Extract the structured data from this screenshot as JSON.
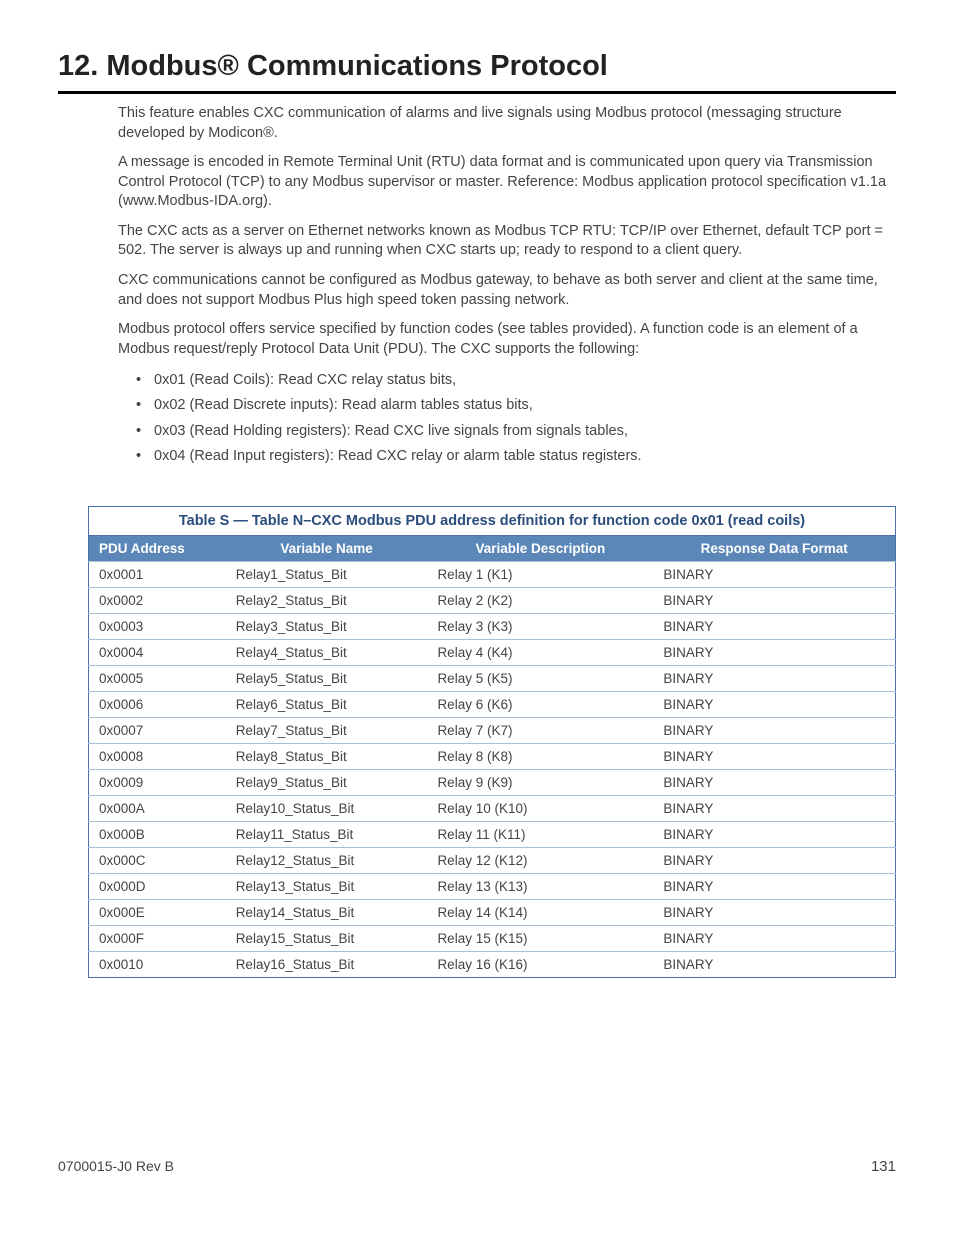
{
  "heading": "12.    Modbus® Communications Protocol",
  "paragraphs": [
    "This feature enables CXC communication of alarms and live signals using Modbus protocol (messaging structure developed by Modicon®.",
    "A message is encoded in Remote Terminal Unit (RTU) data format and is communicated upon query via Transmission Control Protocol (TCP) to any Modbus supervisor or master. Reference: Modbus application protocol specification v1.1a (www.Modbus-IDA.org).",
    "The CXC acts as a server on Ethernet networks known as Modbus TCP RTU: TCP/IP over Ethernet, default TCP port = 502. The server is always up and running when CXC starts up; ready to respond to a client query.",
    "CXC communications cannot be configured as Modbus gateway, to behave as both server and client at the same time, and does not support Modbus Plus high speed token passing network.",
    "Modbus protocol offers service specified by function codes (see tables provided). A function code is an element of a Modbus request/reply Protocol Data Unit (PDU). The CXC supports the following:"
  ],
  "bullets": [
    "0x01 (Read Coils): Read CXC relay status bits,",
    "0x02 (Read Discrete inputs): Read alarm tables status bits,",
    "0x03 (Read Holding registers): Read CXC live signals from signals tables,",
    "0x04 (Read Input registers): Read CXC relay or alarm table status registers."
  ],
  "table": {
    "title": "Table S  —  Table N–CXC Modbus PDU address definition for function code 0x01 (read coils)",
    "columns": [
      "PDU Address",
      "Variable Name",
      "Variable Description",
      "Response Data Format"
    ],
    "rows": [
      [
        "0x0001",
        "Relay1_Status_Bit",
        "Relay 1 (K1)",
        "BINARY"
      ],
      [
        "0x0002",
        "Relay2_Status_Bit",
        "Relay 2 (K2)",
        "BINARY"
      ],
      [
        "0x0003",
        "Relay3_Status_Bit",
        "Relay 3 (K3)",
        "BINARY"
      ],
      [
        "0x0004",
        "Relay4_Status_Bit",
        "Relay 4 (K4)",
        "BINARY"
      ],
      [
        "0x0005",
        "Relay5_Status_Bit",
        "Relay 5 (K5)",
        "BINARY"
      ],
      [
        "0x0006",
        "Relay6_Status_Bit",
        "Relay 6 (K6)",
        "BINARY"
      ],
      [
        "0x0007",
        "Relay7_Status_Bit",
        "Relay 7 (K7)",
        "BINARY"
      ],
      [
        "0x0008",
        "Relay8_Status_Bit",
        "Relay 8 (K8)",
        "BINARY"
      ],
      [
        "0x0009",
        "Relay9_Status_Bit",
        "Relay 9 (K9)",
        "BINARY"
      ],
      [
        "0x000A",
        "Relay10_Status_Bit",
        "Relay 10 (K10)",
        "BINARY"
      ],
      [
        "0x000B",
        "Relay11_Status_Bit",
        "Relay 11 (K11)",
        "BINARY"
      ],
      [
        "0x000C",
        "Relay12_Status_Bit",
        "Relay 12 (K12)",
        "BINARY"
      ],
      [
        "0x000D",
        "Relay13_Status_Bit",
        "Relay 13 (K13)",
        "BINARY"
      ],
      [
        "0x000E",
        "Relay14_Status_Bit",
        "Relay 14 (K14)",
        "BINARY"
      ],
      [
        "0x000F",
        "Relay15_Status_Bit",
        "Relay 15 (K15)",
        "BINARY"
      ],
      [
        "0x0010",
        "Relay16_Status_Bit",
        "Relay 16 (K16)",
        "BINARY"
      ]
    ]
  },
  "footer": {
    "docnum": "0700015-J0    Rev B",
    "pagenum": "131"
  }
}
